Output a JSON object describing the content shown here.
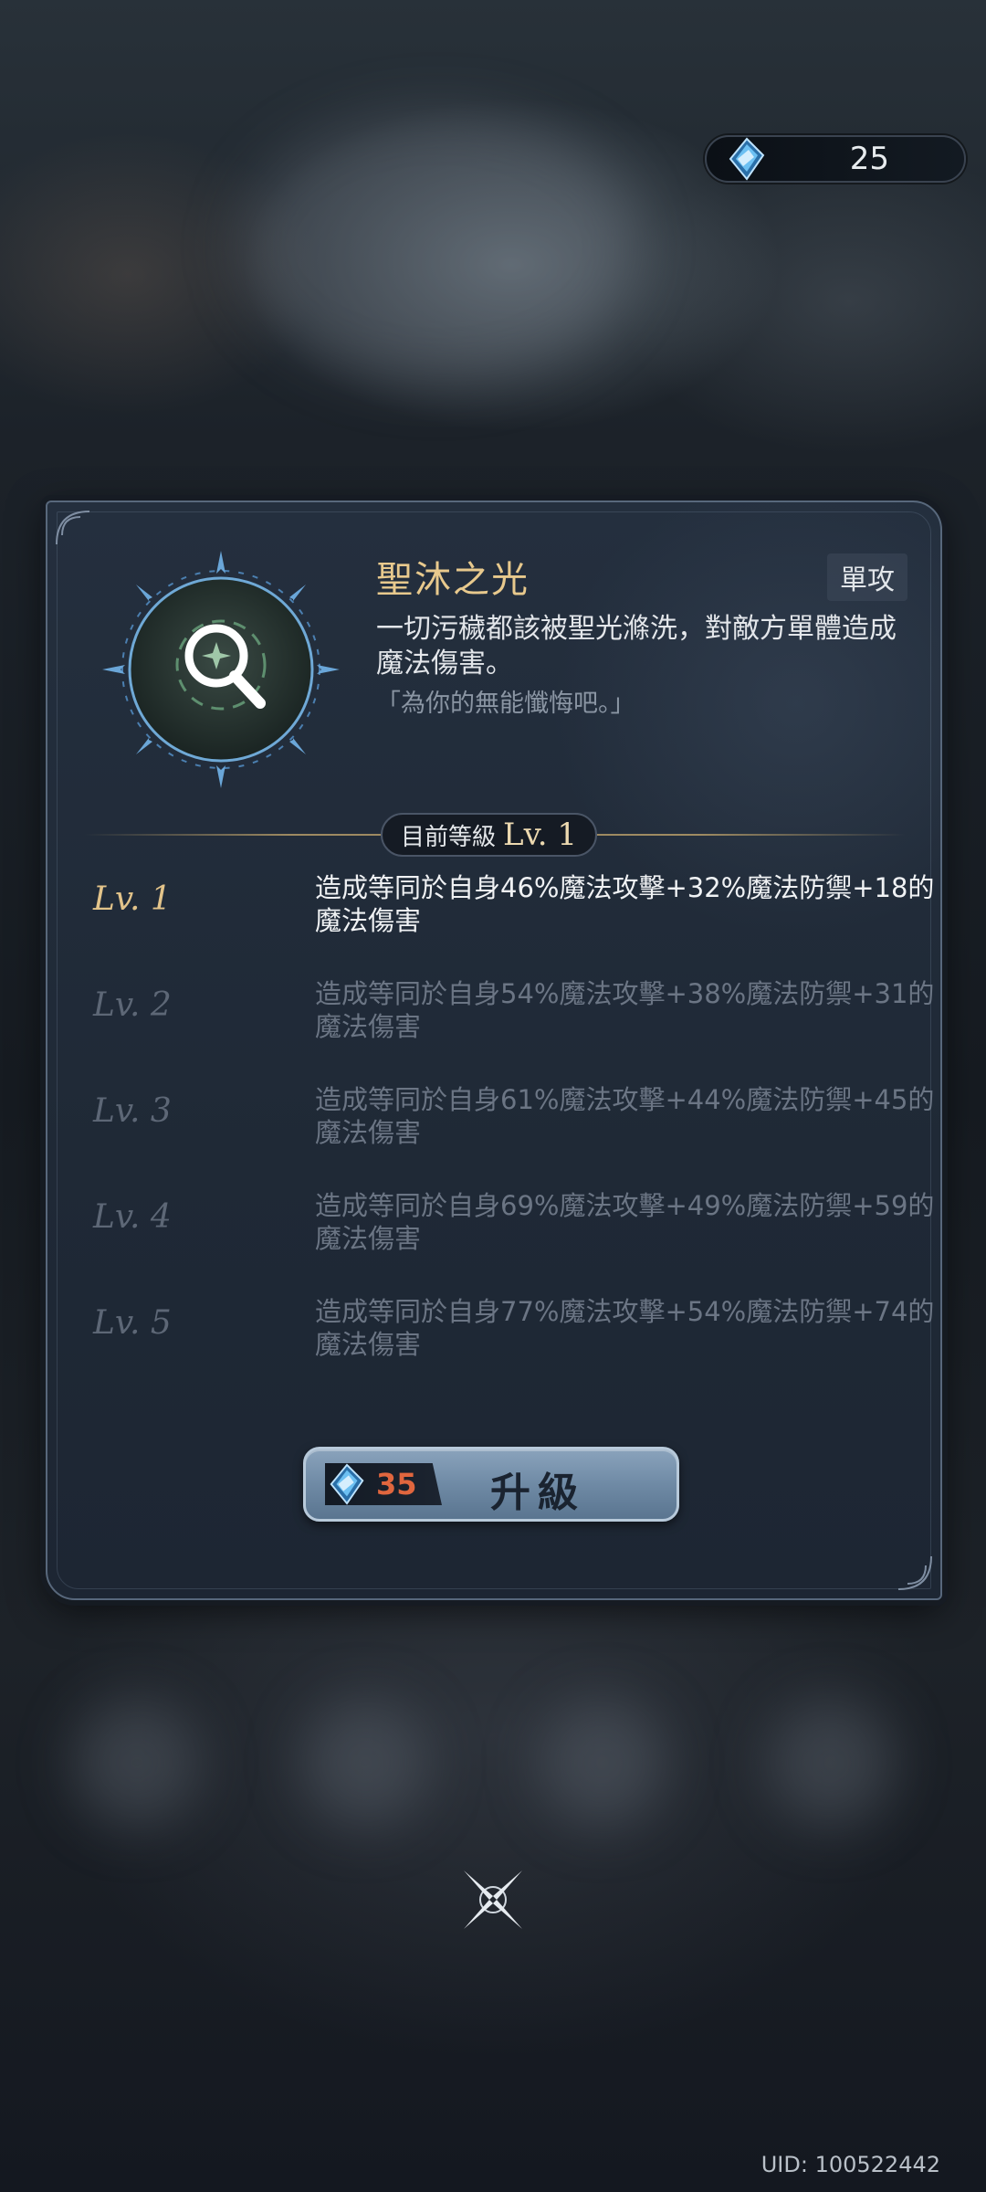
{
  "currency": {
    "icon": "crystal-gem-icon",
    "amount": "25"
  },
  "skill": {
    "name": "聖沐之光",
    "tag": "單攻",
    "icon": "magnifier-rune-icon",
    "description": "一切污穢都該被聖光滌洗，對敵方單體造成魔法傷害。",
    "quote": "「為你的無能懺悔吧。」"
  },
  "current_level": {
    "label": "目前等級",
    "value": "Lv. 1"
  },
  "levels": [
    {
      "tag": "Lv. 1",
      "text": "造成等同於自身46%魔法攻擊+32%魔法防禦+18的魔法傷害"
    },
    {
      "tag": "Lv. 2",
      "text": "造成等同於自身54%魔法攻擊+38%魔法防禦+31的魔法傷害"
    },
    {
      "tag": "Lv. 3",
      "text": "造成等同於自身61%魔法攻擊+44%魔法防禦+45的魔法傷害"
    },
    {
      "tag": "Lv. 4",
      "text": "造成等同於自身69%魔法攻擊+49%魔法防禦+59的魔法傷害"
    },
    {
      "tag": "Lv. 5",
      "text": "造成等同於自身77%魔法攻擊+54%魔法防禦+74的魔法傷害"
    }
  ],
  "upgrade": {
    "cost": "35",
    "label": "升級"
  },
  "uid": "UID: 100522442",
  "colors": {
    "gold": "#e3c48a",
    "cost_red": "#e0663e",
    "button": "#7a94ae"
  }
}
